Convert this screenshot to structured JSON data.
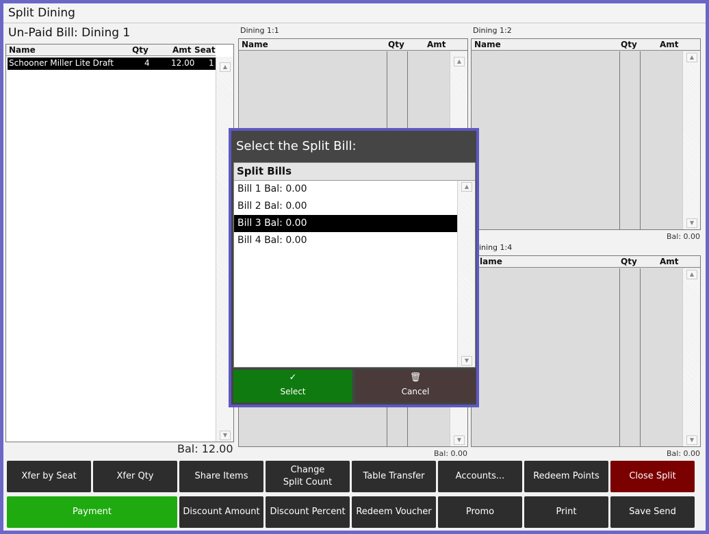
{
  "window": {
    "title": "Split Dining"
  },
  "unpaid": {
    "heading": "Un-Paid Bill: Dining 1",
    "columns": {
      "name": "Name",
      "qty": "Qty",
      "amt": "Amt",
      "seat": "Seat"
    },
    "rows": [
      {
        "name": "Schooner Miller Lite Draft",
        "qty": "4",
        "amt": "12.00",
        "seat": "1"
      }
    ],
    "balance": "Bal: 12.00"
  },
  "splits": {
    "s1": {
      "label": "Dining 1:1",
      "bal": "Bal: 0.00"
    },
    "s2": {
      "label": "Dining 1:2",
      "bal": "Bal: 0.00"
    },
    "s4": {
      "label": "ining 1:4",
      "bal": "Bal: 0.00"
    },
    "columns": {
      "name": "Name",
      "qty": "Qty",
      "amt": "Amt"
    },
    "name_partial": "lame"
  },
  "buttons": {
    "xfer_seat": "Xfer by Seat",
    "xfer_qty": "Xfer Qty",
    "share_items": "Share Items",
    "change_split_count": "Change Split Count",
    "table_transfer": "Table Transfer",
    "accounts": "Accounts...",
    "redeem_points": "Redeem Points",
    "close_split": "Close Split",
    "payment": "Payment",
    "discount_amount": "Discount Amount",
    "discount_percent": "Discount Percent",
    "redeem_voucher": "Redeem Voucher",
    "promo": "Promo",
    "print": "Print",
    "save_send": "Save Send"
  },
  "modal": {
    "title": "Select the Split Bill:",
    "list_header": "Split Bills",
    "items": [
      "Bill 1 Bal: 0.00",
      "Bill 2 Bal: 0.00",
      "Bill 3 Bal: 0.00",
      "Bill 4 Bal: 0.00"
    ],
    "selected_index": 2,
    "select_label": "Select",
    "cancel_label": "Cancel"
  },
  "colors": {
    "frame": "#6b67c7",
    "payment": "#1faa0f",
    "close_split": "#7b0000",
    "select": "#0f7a0f",
    "cancel": "#4a3a3a"
  }
}
